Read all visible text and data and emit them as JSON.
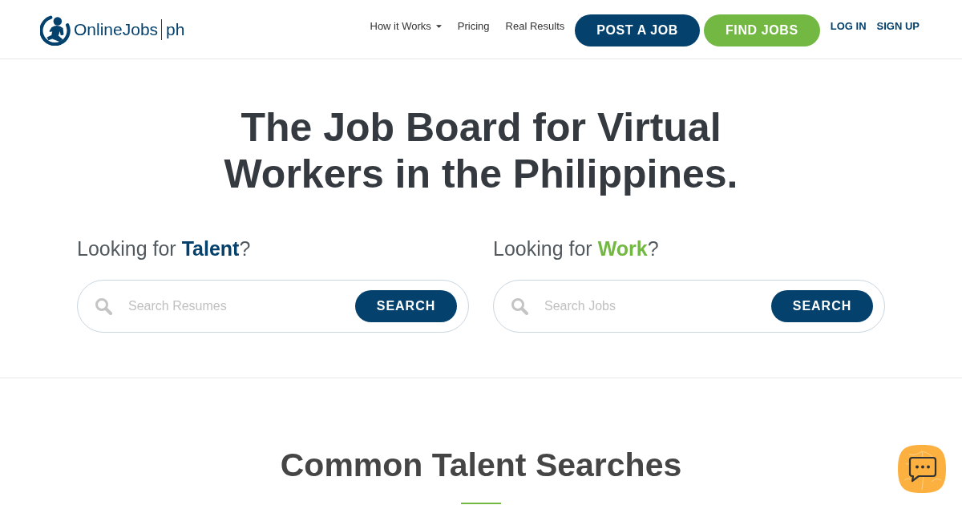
{
  "header": {
    "logo": {
      "name": "OnlineJobs",
      "suffix": "ph"
    },
    "nav": [
      {
        "label": "How it Works",
        "kind": "dropdown"
      },
      {
        "label": "Pricing",
        "kind": "link"
      },
      {
        "label": "Real Results",
        "kind": "link"
      },
      {
        "label": "POST A JOB",
        "kind": "button",
        "color": "#04416d"
      },
      {
        "label": "FIND JOBS",
        "kind": "button",
        "color": "#72b843"
      },
      {
        "label": "LOG IN",
        "kind": "auth"
      },
      {
        "label": "SIGN UP",
        "kind": "auth"
      }
    ]
  },
  "hero": {
    "title": "The Job Board for Virtual Workers in the Philippines.",
    "panels": [
      {
        "heading": "Looking for **Talent**?",
        "color": "#04416d",
        "search": {
          "placeholder": "Search Resumes",
          "button": "SEARCH"
        }
      },
      {
        "heading": "Looking for **Work**?",
        "color": "#72b843",
        "search": {
          "placeholder": "Search Jobs",
          "button": "SEARCH"
        }
      }
    ]
  },
  "section": {
    "title": "Common Talent Searches"
  }
}
